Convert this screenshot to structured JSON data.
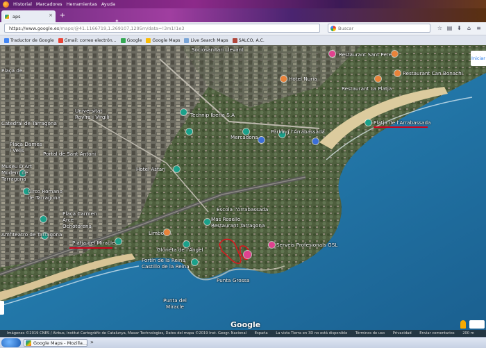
{
  "browser": {
    "menu": [
      "Historial",
      "Marcadores",
      "Herramientas",
      "Ayuda"
    ],
    "tab": {
      "title": "aps",
      "close": "×"
    },
    "newtab": "+",
    "url_main": "https://www.google.es",
    "url_rest": "/maps/@41.1166719,1.269107,1295m/data=!3m1!1e3",
    "search_placeholder": "Buscar",
    "bookmarks": [
      {
        "label": "Traductor de Google",
        "color": "#4285f4"
      },
      {
        "label": "Gmail: correo electrón...",
        "color": "#ea4335"
      },
      {
        "label": "Google",
        "color": "#34a853"
      },
      {
        "label": "Google Maps",
        "color": "#fbbc05"
      },
      {
        "label": "Live Search Maps",
        "color": "#7aa6d8"
      },
      {
        "label": "SALCO, A.C.",
        "color": "#b0463a"
      }
    ]
  },
  "map": {
    "labels": {
      "sociosanitari": "Sociosanitari Llevant",
      "restaurant_sant_pere": "Restaurant Sant Pere",
      "restaurant_can_bonachi": "Restaurant Can Bonachi",
      "hotel_nuria": "Hotel Nuria",
      "restaurant_platja": "Restaurant La Platja",
      "placa": "Plaça de",
      "universitat": "Universitat Rovira i Virgili",
      "catedral": "Catedral de Tarragona",
      "technip": "Technip Iberia S.A",
      "platja_arrabassada": "Platja de l'Arrabassada",
      "placa_dames": "Plaça Dames i Vells",
      "portal": "Portal de Sant Antoni",
      "parking": "Parking l'Arrabassada",
      "mercadona": "Mercadona",
      "museu": "Museu D'Art Modern de Tarragona",
      "hotel_astari": "Hotel Astari",
      "circ": "Circo Romano de Tarragona",
      "placa_carmen": "Plaça Carmen Arce Ochotorena",
      "escola": "Escola l'Arrabassada",
      "mas_rosello": "Mas Rosello Restaurant Tarragona",
      "amfiteatre": "Amfiteatro de Tarragona",
      "platja_miracle": "Platja del Miracle",
      "limbo": "Limbo",
      "serveis": "Serveis Profesionals GSL",
      "glorieta": "Glorieta de l'Àngel",
      "fortin": "Fortín de la Reina Castillo de la Reina",
      "punta_grossa": "Punta Grossa",
      "punta_miracle": "Punta del Miracle"
    },
    "iniciar": "Iniciar",
    "google_logo": "Google",
    "attribution": "Imágenes ©2019 CNES / Airbus, Institut Cartogràfic de Catalunya, Maxar Technologies, Datos del mapa ©2019 Inst. Geogr. Nacional",
    "attrib_right": [
      "España",
      "La vista Tierra en 3D no está disponible",
      "Términos de uso",
      "Privacidad",
      "Enviar comentarios",
      "200 m"
    ]
  },
  "taskbar": {
    "task_title": "Google Maps - Mozilla..."
  },
  "colors": {
    "sea": "#1f74a6",
    "land": "#5b6a52",
    "beach": "#d9c79a",
    "pin_green": "#1aa18a",
    "pin_orange": "#e8833a",
    "pin_pink": "#e0418f",
    "underline": "#d0021b"
  }
}
